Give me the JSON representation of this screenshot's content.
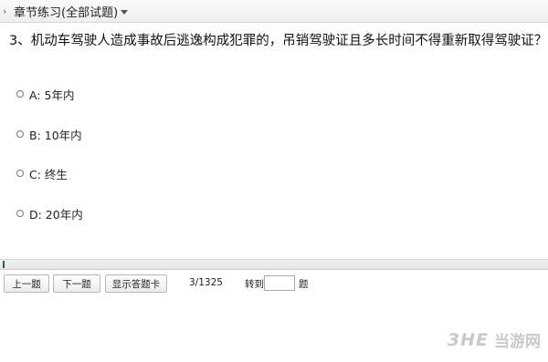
{
  "topbar": {
    "breadcrumb": "章节练习(全部试题)"
  },
  "question": {
    "text": "3、机动车驾驶人造成事故后逃逸构成犯罪的，吊销驾驶证且多长时间不得重新取得驾驶证？",
    "options": [
      {
        "label": "A: 5年内"
      },
      {
        "label": "B: 10年内"
      },
      {
        "label": "C: 终生"
      },
      {
        "label": "D: 20年内"
      }
    ]
  },
  "toolbar": {
    "prev_label": "上一题",
    "next_label": "下一题",
    "card_label": "显示答题卡",
    "counter": "3/1325",
    "goto_label": "转到",
    "goto_value": "",
    "goto_unit": "题"
  },
  "watermark": {
    "logo": "3HE",
    "text": "当游网"
  }
}
